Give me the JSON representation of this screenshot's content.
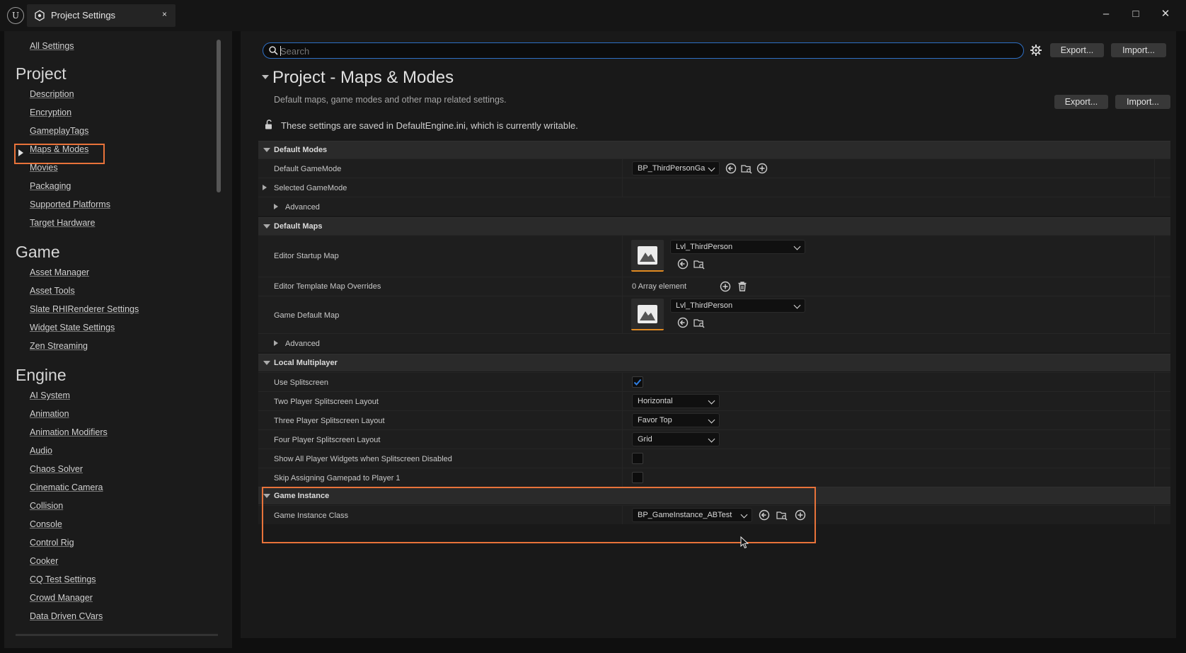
{
  "window": {
    "tab_title": "Project Settings",
    "tab_close": "×",
    "minimize": "–",
    "maximize": "□",
    "close": "✕"
  },
  "sidebar": {
    "all_settings": "All Settings",
    "sections": [
      {
        "header": "Project",
        "items": [
          "Description",
          "Encryption",
          "GameplayTags",
          "Maps & Modes",
          "Movies",
          "Packaging",
          "Supported Platforms",
          "Target Hardware"
        ]
      },
      {
        "header": "Game",
        "items": [
          "Asset Manager",
          "Asset Tools",
          "Slate RHIRenderer Settings",
          "Widget State Settings",
          "Zen Streaming"
        ]
      },
      {
        "header": "Engine",
        "items": [
          "AI System",
          "Animation",
          "Animation Modifiers",
          "Audio",
          "Chaos Solver",
          "Cinematic Camera",
          "Collision",
          "Console",
          "Control Rig",
          "Cooker",
          "CQ Test Settings",
          "Crowd Manager",
          "Data Driven CVars"
        ]
      }
    ],
    "selected": "Maps & Modes"
  },
  "toolbar": {
    "search_placeholder": "Search",
    "export_label": "Export...",
    "import_label": "Import..."
  },
  "page": {
    "title": "Project - Maps & Modes",
    "description": "Default maps, game modes and other map related settings.",
    "export_label": "Export...",
    "import_label": "Import...",
    "writable_note": "These settings are saved in DefaultEngine.ini, which is currently writable."
  },
  "default_modes": {
    "header": "Default Modes",
    "default_gamemode_label": "Default GameMode",
    "default_gamemode_value": "BP_ThirdPersonGa",
    "selected_gamemode_label": "Selected GameMode",
    "advanced_label": "Advanced"
  },
  "default_maps": {
    "header": "Default Maps",
    "editor_startup_map_label": "Editor Startup Map",
    "editor_startup_map_value": "Lvl_ThirdPerson",
    "template_overrides_label": "Editor Template Map Overrides",
    "template_overrides_value": "0 Array element",
    "game_default_map_label": "Game Default Map",
    "game_default_map_value": "Lvl_ThirdPerson",
    "advanced_label": "Advanced"
  },
  "local_multiplayer": {
    "header": "Local Multiplayer",
    "use_splitscreen_label": "Use Splitscreen",
    "use_splitscreen_checked": true,
    "two_player_label": "Two Player Splitscreen Layout",
    "two_player_value": "Horizontal",
    "three_player_label": "Three Player Splitscreen Layout",
    "three_player_value": "Favor Top",
    "four_player_label": "Four Player Splitscreen Layout",
    "four_player_value": "Grid",
    "show_widgets_label": "Show All Player Widgets when Splitscreen Disabled",
    "show_widgets_checked": false,
    "skip_gamepad_label": "Skip Assigning Gamepad to Player 1",
    "skip_gamepad_checked": false
  },
  "game_instance": {
    "header": "Game Instance",
    "class_label": "Game Instance Class",
    "class_value": "BP_GameInstance_ABTest"
  },
  "colors": {
    "highlight": "#e8733a",
    "accent_blue": "#2e6fc4",
    "thumbnail_underline": "#e08a22"
  }
}
